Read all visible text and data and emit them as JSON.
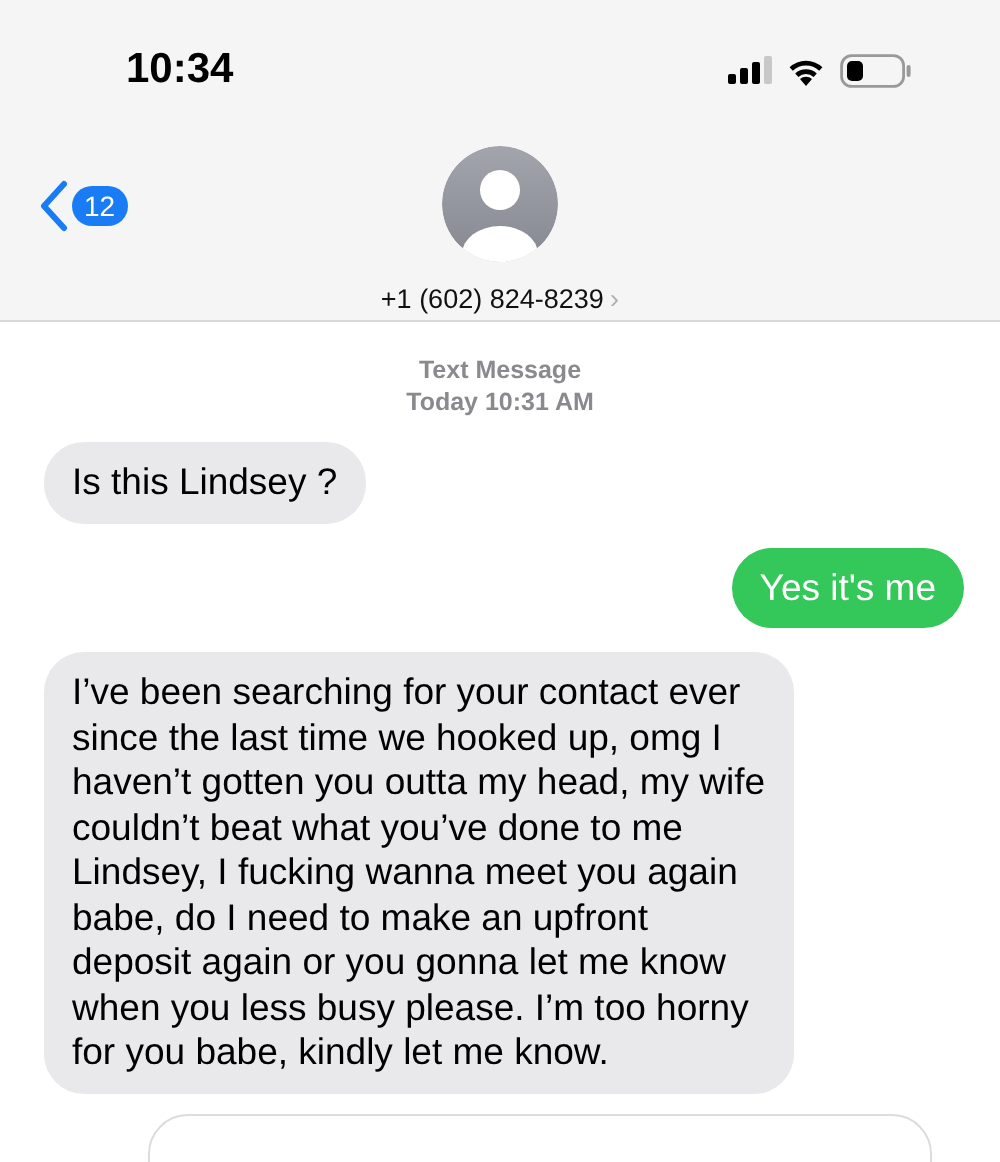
{
  "status_bar": {
    "time": "10:34"
  },
  "header": {
    "back_count": "12",
    "contact": "+1 (602) 824-8239",
    "chevron": "›"
  },
  "thread": {
    "service": "Text Message",
    "timestamp": "Today 10:31 AM"
  },
  "messages": [
    {
      "kind": "incoming",
      "text": "Is this Lindsey ?"
    },
    {
      "kind": "outgoing",
      "text": "Yes it's me"
    },
    {
      "kind": "incoming",
      "text": "I’ve been searching for your contact ever since the last time we hooked up, omg I haven’t gotten you outta my head, my wife couldn’t beat what you’ve done to me Lindsey, I fucking wanna meet you again babe, do I need to make an upfront deposit again or you gonna let me know when you less busy please. I’m too horny for you babe, kindly let me know."
    },
    {
      "kind": "clipped"
    }
  ]
}
